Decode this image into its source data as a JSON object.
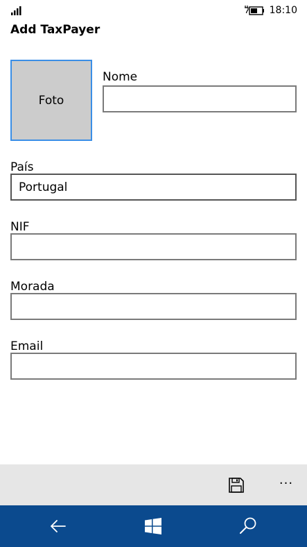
{
  "status_bar": {
    "time": "18:10",
    "icons": [
      "signal-icon",
      "battery-charging-icon"
    ]
  },
  "page": {
    "title": "Add TaxPayer"
  },
  "photo": {
    "label": "Foto"
  },
  "form": {
    "nome_label": "Nome",
    "nome_value": "",
    "pais_label": "País",
    "pais_value": "Portugal",
    "nif_label": "NIF",
    "nif_value": "",
    "morada_label": "Morada",
    "morada_value": "",
    "email_label": "Email",
    "email_value": ""
  },
  "app_bar": {
    "icons": [
      "save-icon",
      "more-icon"
    ],
    "more_label": "···"
  },
  "nav_bar": {
    "icons": [
      "back-arrow-icon",
      "windows-icon",
      "search-icon"
    ]
  },
  "colors": {
    "accent": "#3a8ee6",
    "nav_bar": "#0b4a8e",
    "app_bar": "#e6e6e6",
    "photo_bg": "#cccccc"
  }
}
